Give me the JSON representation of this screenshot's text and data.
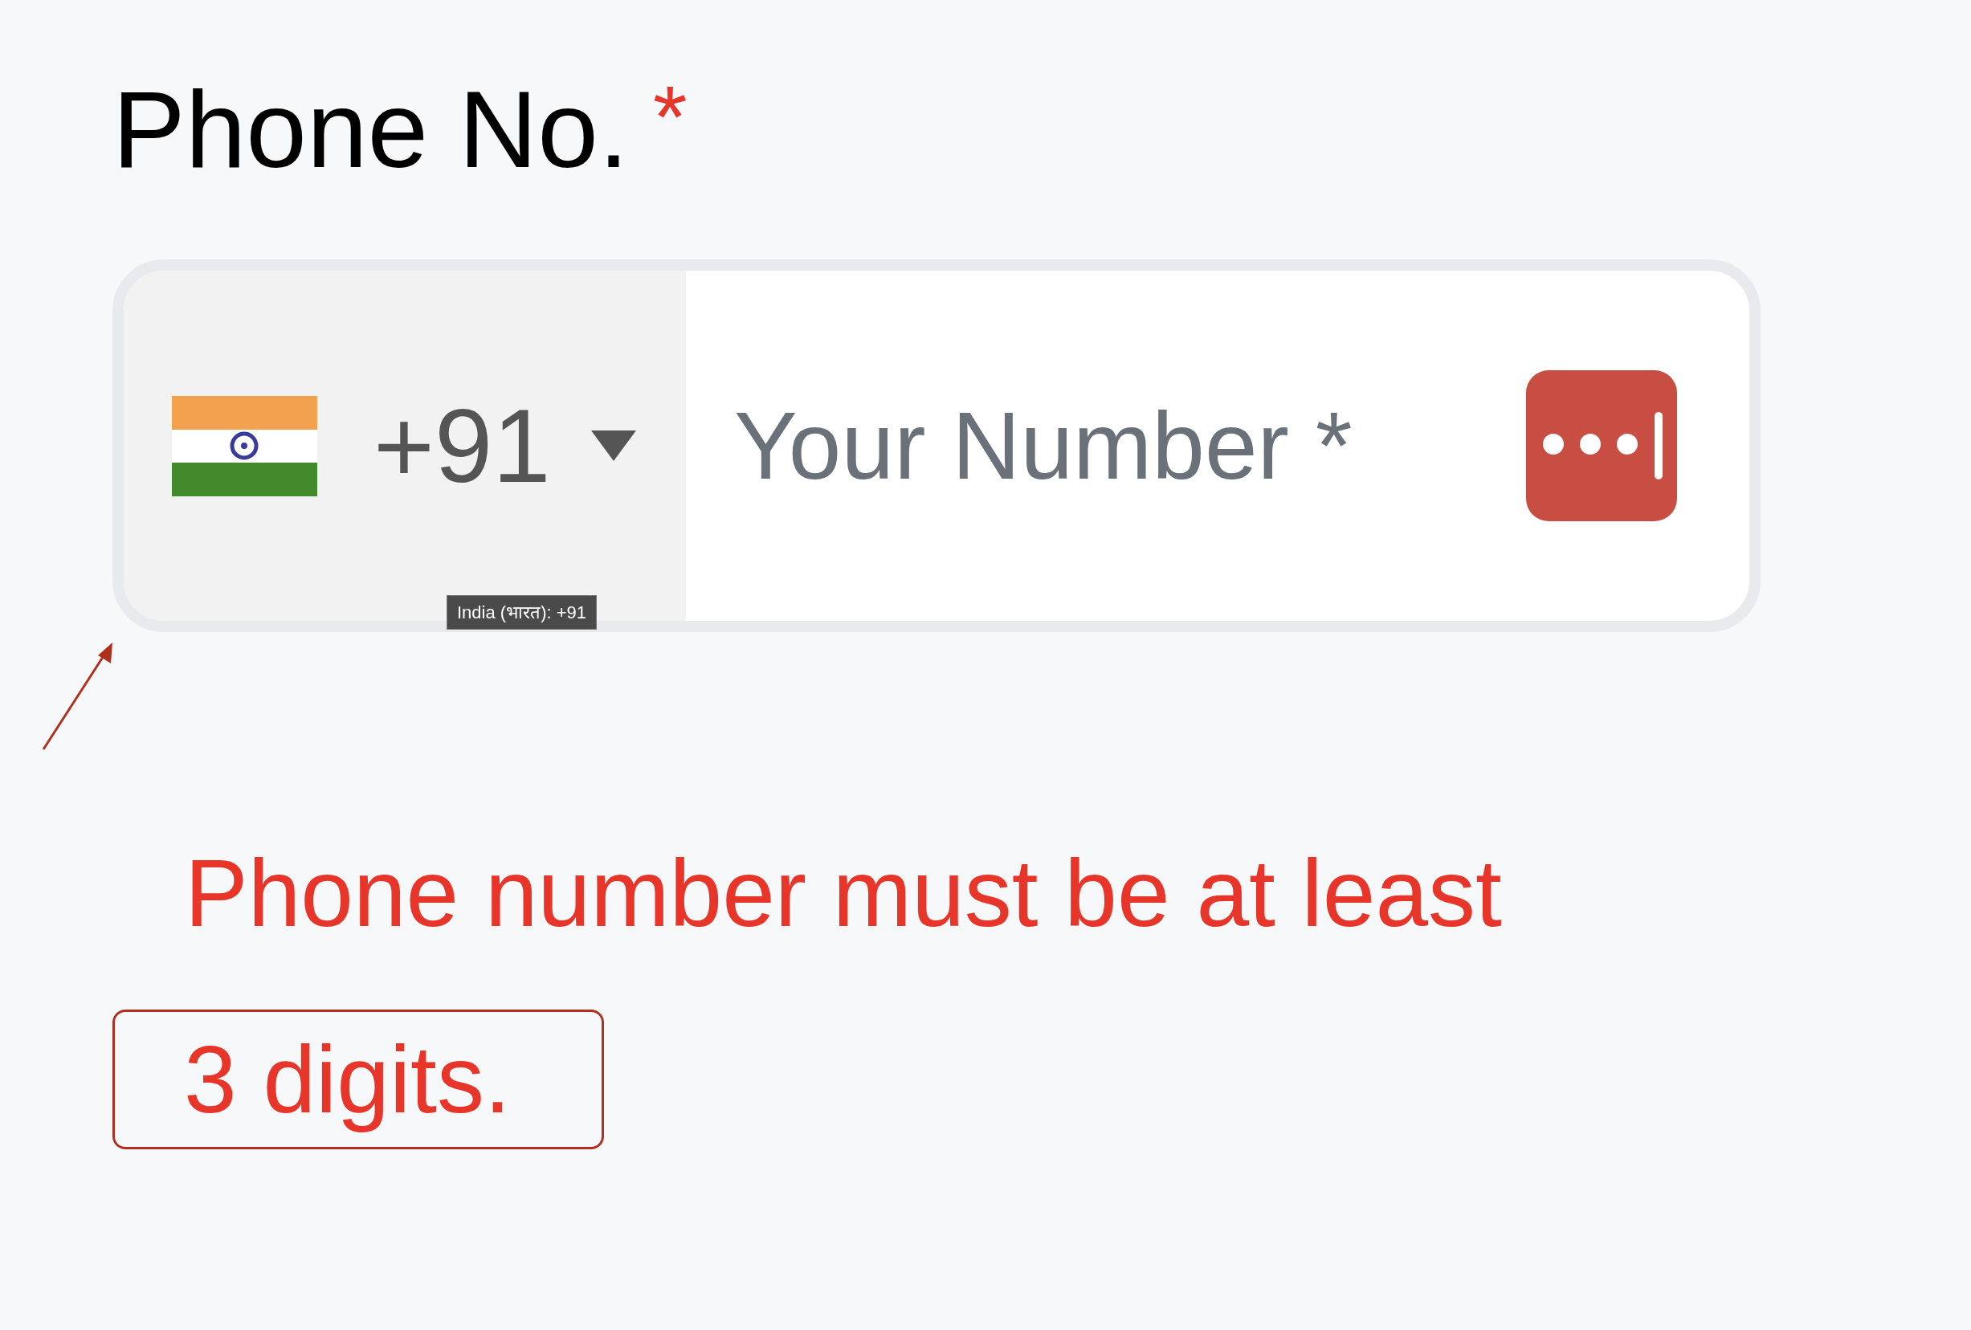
{
  "label": {
    "text": "Phone No.",
    "required_mark": "*"
  },
  "phone_field": {
    "country_code": "+91",
    "placeholder": "Your Number *",
    "tooltip": "India (भारत): +91"
  },
  "error_message": {
    "lines": [
      "Phone number must be at least",
      "3 digits."
    ]
  }
}
